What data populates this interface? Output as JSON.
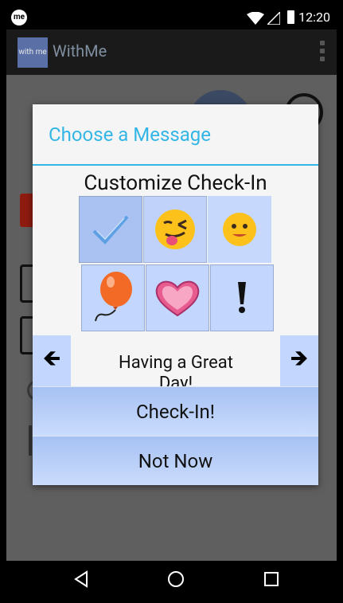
{
  "status_bar": {
    "app_icon_text": "me",
    "time": "12:20"
  },
  "action_bar": {
    "logo_text": "with me",
    "title": "WithMe"
  },
  "dialog": {
    "title": "Choose a Message",
    "customize_title": "Customize Check-In",
    "icons": [
      "checkmark-icon",
      "winking-tongue-emoji-icon",
      "smiling-face-emoji-icon",
      "balloon-icon",
      "heart-icon",
      "exclamation-icon"
    ],
    "arrow_left": "🡸",
    "arrow_right": "🡺",
    "message_text": "Having a Great Day!",
    "checkin_label": "Check-In!",
    "notnow_label": "Not Now"
  }
}
